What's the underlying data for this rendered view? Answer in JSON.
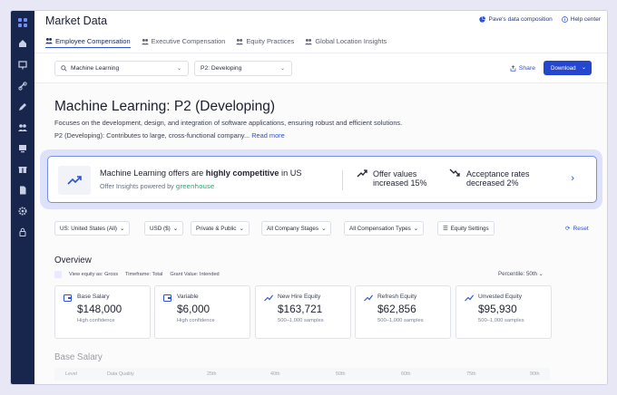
{
  "app": {
    "title": "Market Data"
  },
  "top_links": [
    {
      "label": "Pave's data composition",
      "icon": "pie-chart-icon"
    },
    {
      "label": "Help center",
      "icon": "info-icon"
    }
  ],
  "tabs": [
    {
      "label": "Employee Compensation",
      "active": true
    },
    {
      "label": "Executive Compensation",
      "active": false
    },
    {
      "label": "Equity Practices",
      "active": false
    },
    {
      "label": "Global Location Insights",
      "active": false
    }
  ],
  "search": {
    "value": "Machine Learning"
  },
  "level_select": {
    "value": "P2: Developing"
  },
  "share_label": "Share",
  "download_label": "Download",
  "job": {
    "title": "Machine Learning: P2 (Developing)",
    "description": "Focuses on the development, design, and integration of software applications, ensuring robust and efficient solutions.",
    "level_desc": "P2 (Developing): Contributes to large, cross-functional company...",
    "read_more": "Read more"
  },
  "insight": {
    "head_pre": "Machine Learning offers are ",
    "head_bold": "highly competitive",
    "head_post": " in US",
    "sub_pre": "Offer Insights powered by ",
    "sub_brand": "greenhouse",
    "stat1_line1": "Offer values",
    "stat1_line2": "increased 15%",
    "stat2_line1": "Acceptance rates",
    "stat2_line2": "decreased 2%"
  },
  "filters": [
    {
      "label": "US: United States (All)"
    },
    {
      "label": "USD ($)"
    },
    {
      "label": "Private & Public"
    },
    {
      "label": "All Company Stages"
    },
    {
      "label": "All Compensation Types"
    },
    {
      "label": "Equity Settings"
    }
  ],
  "reset_label": "Reset",
  "overview": {
    "title": "Overview",
    "meta": [
      "View equity as: Gross",
      "Timeframe: Total",
      "Grant Value: Intended"
    ],
    "percentile": "Percentile: 50th"
  },
  "cards": [
    {
      "label": "Base Salary",
      "value": "$148,000",
      "sub": "High confidence"
    },
    {
      "label": "Variable",
      "value": "$6,000",
      "sub": "High confidence"
    },
    {
      "label": "New Hire Equity",
      "value": "$163,721",
      "sub": "500–1,000 samples"
    },
    {
      "label": "Refresh Equity",
      "value": "$62,856",
      "sub": "500–1,000 samples"
    },
    {
      "label": "Unvested Equity",
      "value": "$95,930",
      "sub": "500–1,000 samples"
    }
  ],
  "base_salary": {
    "title": "Base Salary",
    "columns": [
      "Level",
      "Data Quality",
      "25th",
      "40th",
      "50th",
      "60th",
      "75th",
      "90th"
    ]
  },
  "colors": {
    "sidebar": "#18264d",
    "accent": "#2d50d8",
    "greenhouse": "#2aa26c"
  }
}
